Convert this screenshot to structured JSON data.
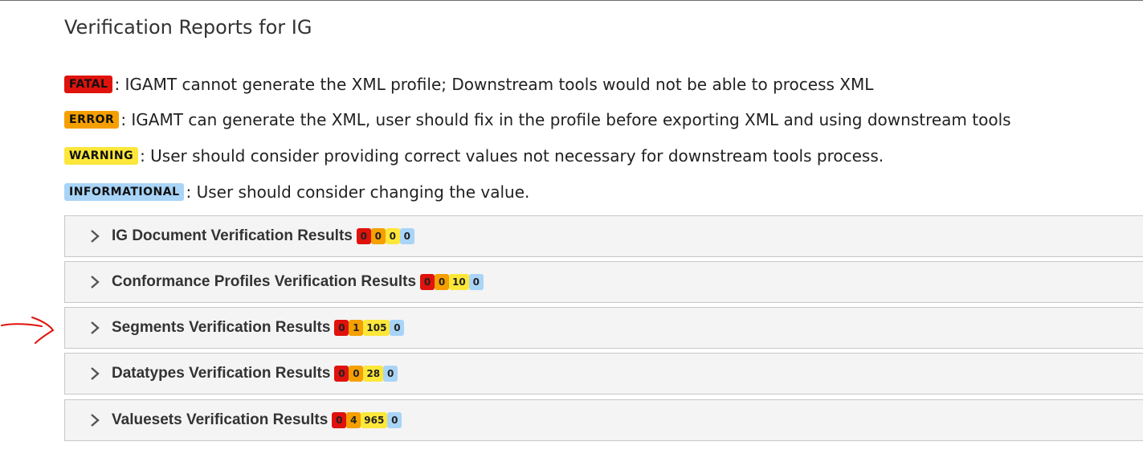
{
  "page_title": "Verification Reports for IG",
  "legend": [
    {
      "tag": "FATAL",
      "desc": ": IGAMT cannot generate the XML profile; Downstream tools would not be able to process XML",
      "color": "#e0120d"
    },
    {
      "tag": "ERROR",
      "desc": ": IGAMT can generate the XML, user should fix in the profile before exporting XML and using downstream tools",
      "color": "#f5a000"
    },
    {
      "tag": "WARNING",
      "desc": ": User should consider providing correct values not necessary for downstream tools process.",
      "color": "#fce73a"
    },
    {
      "tag": "INFORMATIONAL",
      "desc": ": User should consider changing the value.",
      "color": "#a8d4f7"
    }
  ],
  "sections": [
    {
      "title": "IG Document Verification Results",
      "fatal": "0",
      "error": "0",
      "warning": "0",
      "informational": "0"
    },
    {
      "title": "Conformance Profiles Verification Results",
      "fatal": "0",
      "error": "0",
      "warning": "10",
      "informational": "0"
    },
    {
      "title": "Segments Verification Results",
      "fatal": "0",
      "error": "1",
      "warning": "105",
      "informational": "0"
    },
    {
      "title": "Datatypes Verification Results",
      "fatal": "0",
      "error": "0",
      "warning": "28",
      "informational": "0"
    },
    {
      "title": "Valuesets Verification Results",
      "fatal": "0",
      "error": "4",
      "warning": "965",
      "informational": "0"
    }
  ],
  "icons": {
    "expand": "chevron-right-icon",
    "annotation": "red-arrow-annotation"
  },
  "colors": {
    "fatal": "#e0120d",
    "error": "#f5a000",
    "warning": "#fce73a",
    "informational": "#a8d4f7",
    "annotation": "#e0120d"
  }
}
